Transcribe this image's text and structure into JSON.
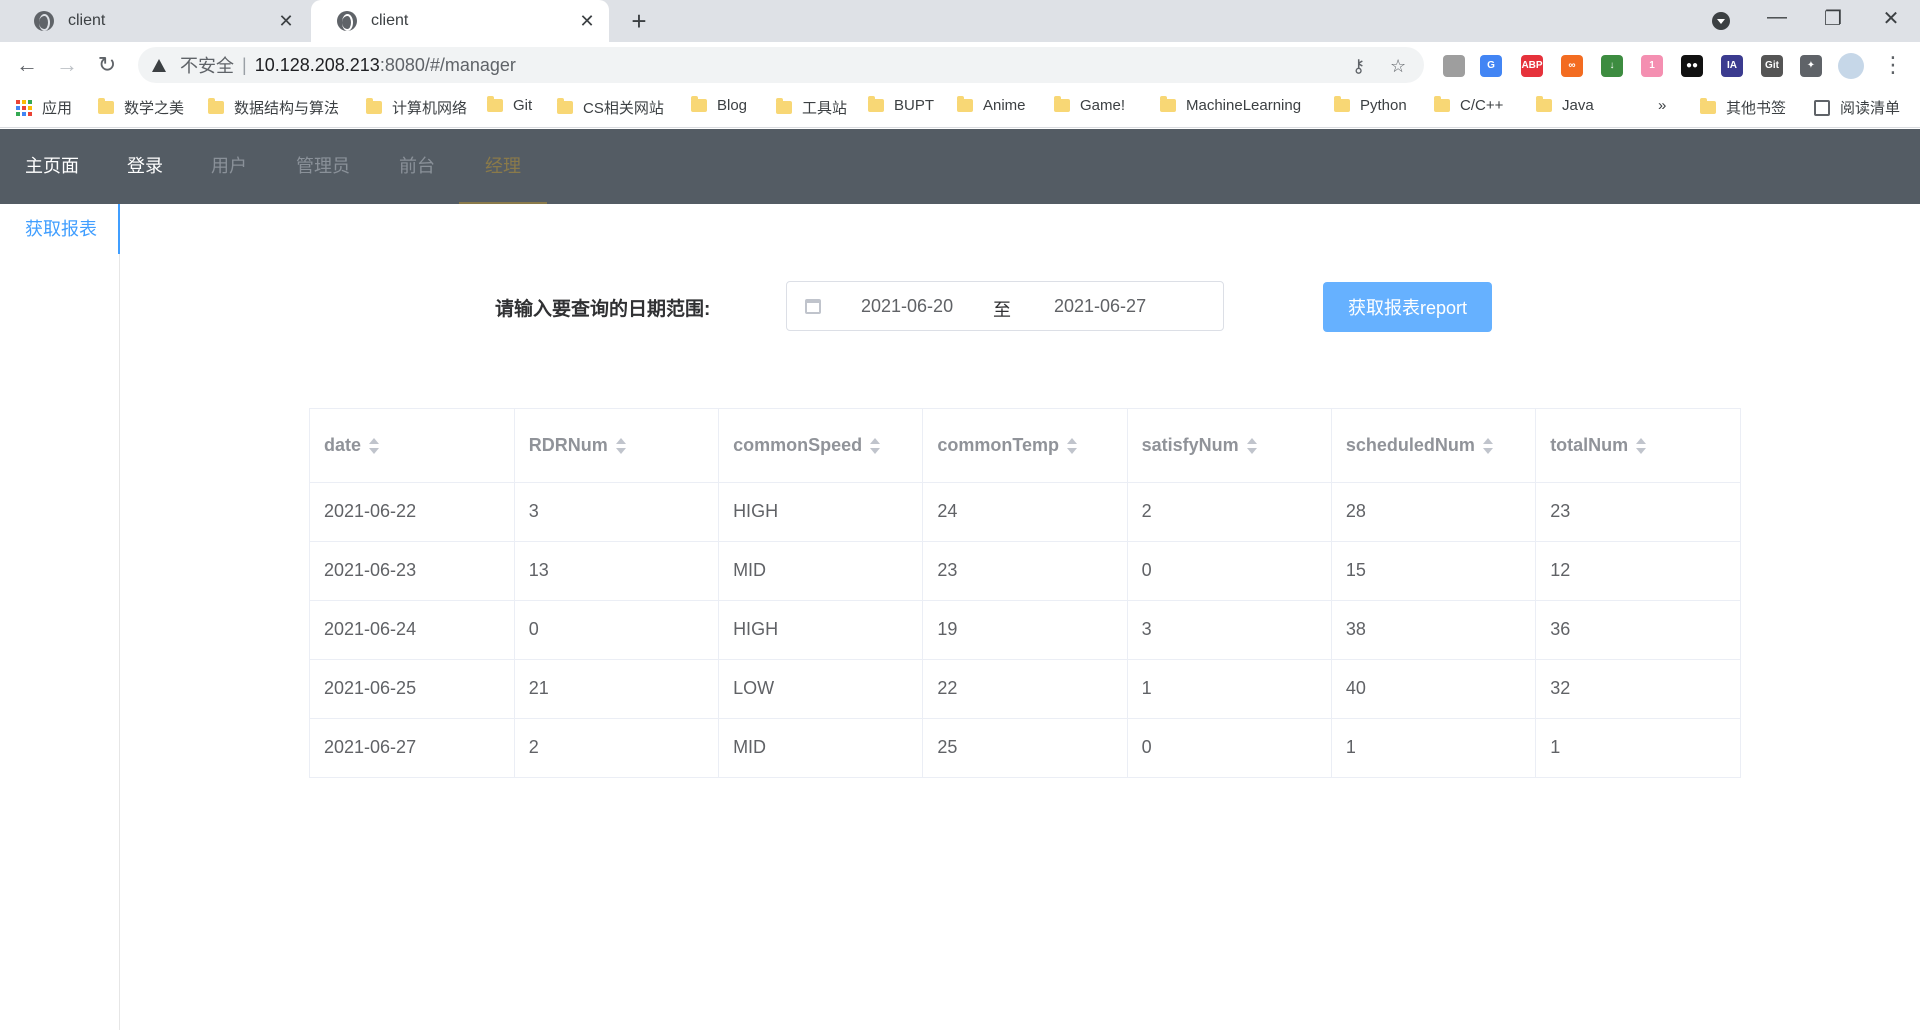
{
  "browser": {
    "tabs": [
      {
        "title": "client",
        "active": false
      },
      {
        "title": "client",
        "active": true
      }
    ],
    "address": {
      "security_label": "不安全",
      "separator": "|",
      "host": "10.128.208.213",
      "path": ":8080/#/manager"
    },
    "bookmarks": [
      {
        "label": "应用",
        "icon": "apps-grid-icon"
      },
      {
        "label": "数学之美",
        "icon": "folder-icon"
      },
      {
        "label": "数据结构与算法",
        "icon": "folder-icon"
      },
      {
        "label": "计算机网络",
        "icon": "folder-icon"
      },
      {
        "label": "Git",
        "icon": "folder-icon"
      },
      {
        "label": "CS相关网站",
        "icon": "folder-icon"
      },
      {
        "label": "Blog",
        "icon": "folder-icon"
      },
      {
        "label": "工具站",
        "icon": "folder-icon"
      },
      {
        "label": "BUPT",
        "icon": "folder-icon"
      },
      {
        "label": "Anime",
        "icon": "folder-icon"
      },
      {
        "label": "Game!",
        "icon": "folder-icon"
      },
      {
        "label": "MachineLearning",
        "icon": "folder-icon"
      },
      {
        "label": "Python",
        "icon": "folder-icon"
      },
      {
        "label": "C/C++",
        "icon": "folder-icon"
      },
      {
        "label": "Java",
        "icon": "folder-icon"
      }
    ],
    "bookmarks_overflow": "»",
    "other_bookmarks": "其他书签",
    "reading_list": "阅读清单",
    "extensions": [
      {
        "name": "ext-grey",
        "color": "#9e9e9e",
        "text": ""
      },
      {
        "name": "google-translate",
        "color": "#4285f4",
        "text": "G"
      },
      {
        "name": "adblock-plus",
        "color": "#e6323b",
        "text": "ABP"
      },
      {
        "name": "infinity",
        "color": "#f36c21",
        "text": "∞"
      },
      {
        "name": "download-helper",
        "color": "#3d8c40",
        "text": "↓"
      },
      {
        "name": "cat-ext",
        "color": "#f48fb1",
        "text": "1"
      },
      {
        "name": "tampermonkey",
        "color": "#111111",
        "text": "●●"
      },
      {
        "name": "ia-ext",
        "color": "#3b3b8f",
        "text": "IA"
      },
      {
        "name": "gitzip",
        "color": "#555555",
        "text": "Git"
      },
      {
        "name": "puzzle",
        "color": "#5f6368",
        "text": "✦"
      }
    ]
  },
  "app": {
    "menu": [
      {
        "label": "主页面",
        "state": "enabled"
      },
      {
        "label": "登录",
        "state": "enabled"
      },
      {
        "label": "用户",
        "state": "disabled"
      },
      {
        "label": "管理员",
        "state": "disabled"
      },
      {
        "label": "前台",
        "state": "disabled"
      },
      {
        "label": "经理",
        "state": "active"
      }
    ],
    "sidebar": {
      "items": [
        {
          "label": "获取报表"
        }
      ]
    },
    "query": {
      "label": "请输入要查询的日期范围:",
      "start_date": "2021-06-20",
      "range_separator": "至",
      "end_date": "2021-06-27",
      "button_label": "获取报表report"
    },
    "table": {
      "columns": [
        "date",
        "RDRNum",
        "commonSpeed",
        "commonTemp",
        "satisfyNum",
        "scheduledNum",
        "totalNum"
      ],
      "rows": [
        [
          "2021-06-22",
          "3",
          "HIGH",
          "24",
          "2",
          "28",
          "23"
        ],
        [
          "2021-06-23",
          "13",
          "MID",
          "23",
          "0",
          "15",
          "12"
        ],
        [
          "2021-06-24",
          "0",
          "HIGH",
          "19",
          "3",
          "38",
          "36"
        ],
        [
          "2021-06-25",
          "21",
          "LOW",
          "22",
          "1",
          "40",
          "32"
        ],
        [
          "2021-06-27",
          "2",
          "MID",
          "25",
          "0",
          "1",
          "1"
        ]
      ]
    },
    "colors": {
      "header_bg": "#545c64",
      "active_menu": "#8a7a4a",
      "accent": "#409eff",
      "button_bg": "#66b1ff"
    }
  }
}
